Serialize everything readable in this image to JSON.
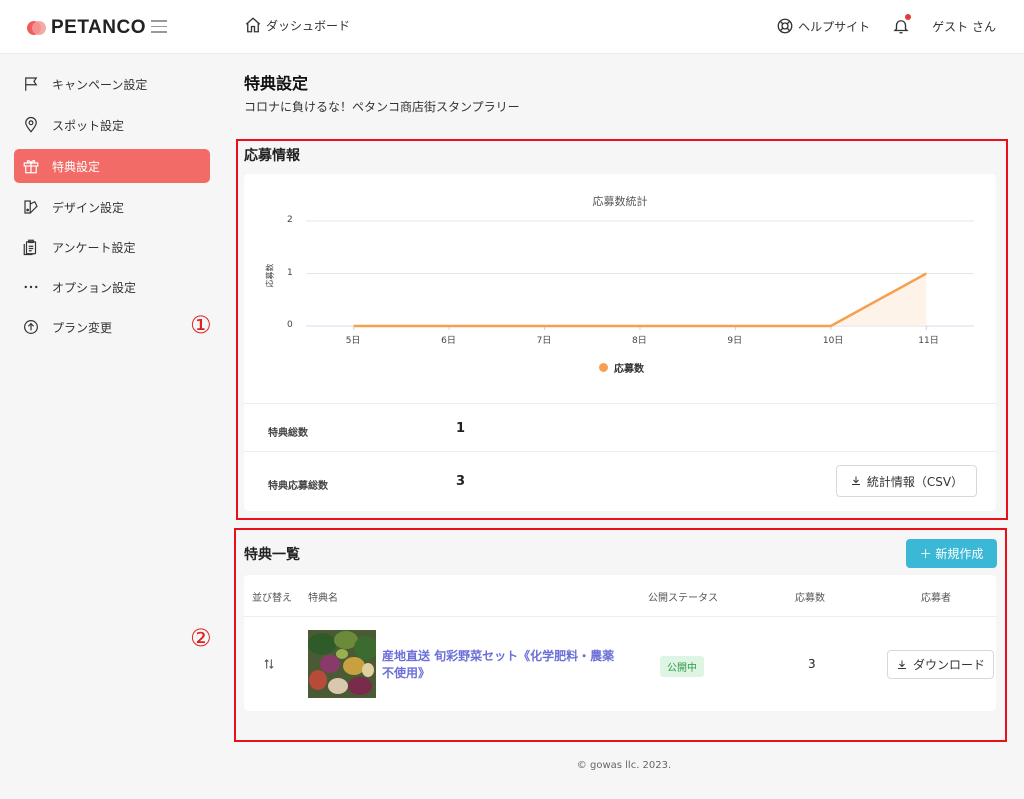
{
  "header": {
    "logo": "PETANCO",
    "breadcrumb": "ダッシュボード",
    "help": "ヘルプサイト",
    "user": "ゲスト さん"
  },
  "sidebar": {
    "items": [
      {
        "label": "キャンペーン設定",
        "icon": "flag-icon"
      },
      {
        "label": "スポット設定",
        "icon": "map-pin-icon"
      },
      {
        "label": "特典設定",
        "icon": "gift-icon",
        "active": true
      },
      {
        "label": "デザイン設定",
        "icon": "palette-icon"
      },
      {
        "label": "アンケート設定",
        "icon": "clipboard-icon"
      },
      {
        "label": "オプション設定",
        "icon": "dots-icon"
      },
      {
        "label": "プラン変更",
        "icon": "arrow-up-circle-icon"
      }
    ]
  },
  "annotations": [
    "①",
    "②"
  ],
  "page": {
    "title": "特典設定",
    "subtitle": "コロナに負けるな！ペタンコ商店街スタンプラリー"
  },
  "entry_info": {
    "title": "応募情報",
    "stats": [
      {
        "label": "特典総数",
        "value": "1"
      },
      {
        "label": "特典応募総数",
        "value": "3"
      }
    ],
    "csv_button": "統計情報（CSV）"
  },
  "chart_data": {
    "type": "area",
    "title": "応募数統計",
    "xlabel": "",
    "ylabel": "応募数",
    "categories": [
      "5日",
      "6日",
      "7日",
      "8日",
      "9日",
      "10日",
      "11日"
    ],
    "series": [
      {
        "name": "応募数",
        "values": [
          0,
          0,
          0,
          0,
          0,
          0,
          1
        ]
      }
    ],
    "ylim": [
      0,
      2
    ],
    "yticks": [
      "0",
      "1",
      "2"
    ],
    "grid": true,
    "legend": "bottom",
    "color": "#f5a050"
  },
  "prize_list": {
    "title": "特典一覧",
    "new_button": "＋ 新規作成",
    "columns": [
      "並び替え",
      "特典名",
      "公開ステータス",
      "応募数",
      "応募者"
    ],
    "rows": [
      {
        "name_line1": "産地直送 旬彩野菜セット《化学肥料・農薬",
        "name_line2": "不使用》",
        "status": "公開中",
        "count": "3",
        "download": "ダウンロード"
      }
    ]
  },
  "footer": "© gowas llc. 2023."
}
